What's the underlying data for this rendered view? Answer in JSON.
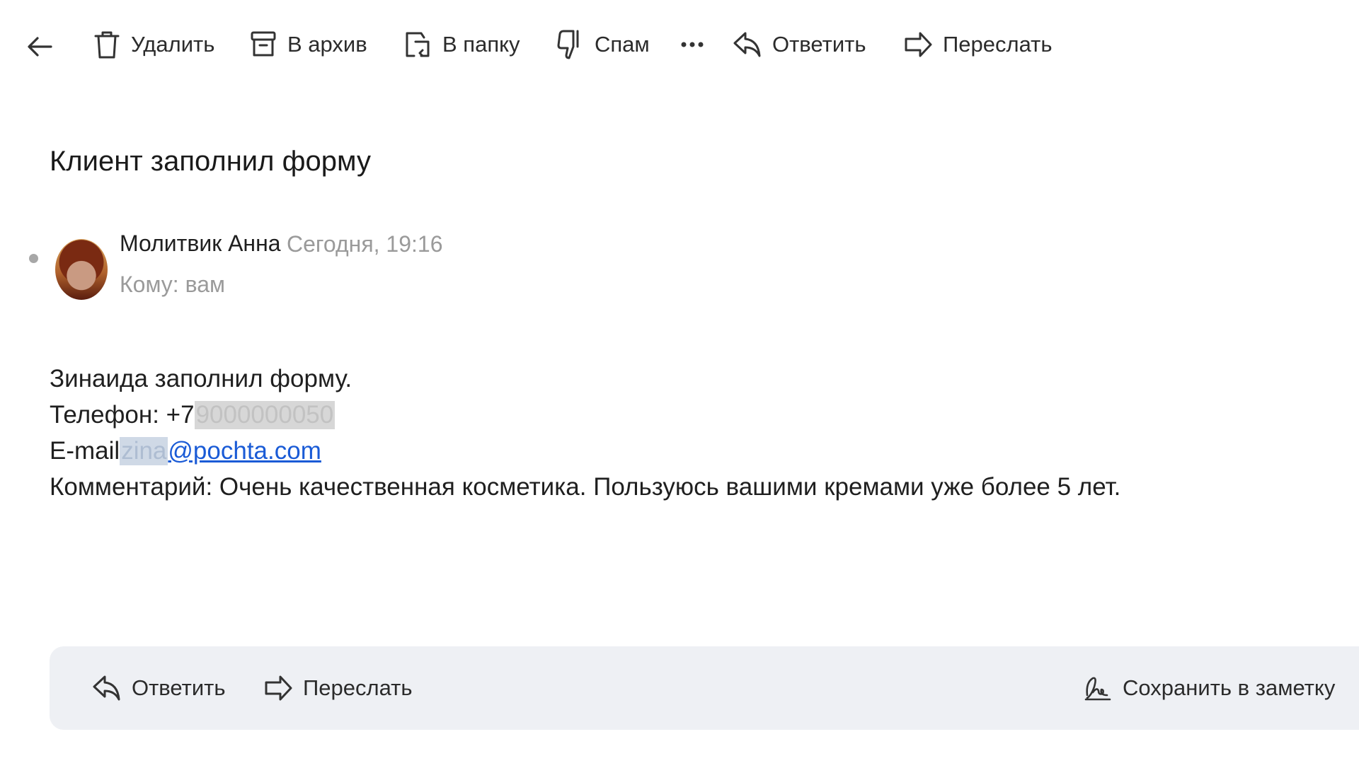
{
  "toolbar": {
    "back_icon": "arrow-left-icon",
    "delete_label": "Удалить",
    "archive_label": "В архив",
    "folder_label": "В папку",
    "spam_label": "Спам",
    "more_icon": "more-dots-icon",
    "reply_label": "Ответить",
    "forward_label": "Переслать"
  },
  "message": {
    "subject": "Клиент заполнил форму",
    "sender_name": "Молитвик Анна",
    "time": "Сегодня, 19:16",
    "recipient": "Кому: вам",
    "unread_color": "#a7a7a7",
    "body": {
      "line1": "Зинаида заполнил форму.",
      "phone_prefix": "Телефон: +7",
      "phone_hidden": "9000000050",
      "email_prefix": "E-mail",
      "email_hidden": "zina",
      "email_domain": "@pochta.com",
      "comment": "Комментарий: Очень качественная косметика. Пользуюсь вашими кремами уже более 5 лет."
    }
  },
  "bottom_bar": {
    "reply_label": "Ответить",
    "forward_label": "Переслать",
    "note_label": "Сохранить в заметку",
    "background": "#eef0f4"
  },
  "colors": {
    "link": "#1a5bd6",
    "muted_text": "#9a9a9a"
  }
}
